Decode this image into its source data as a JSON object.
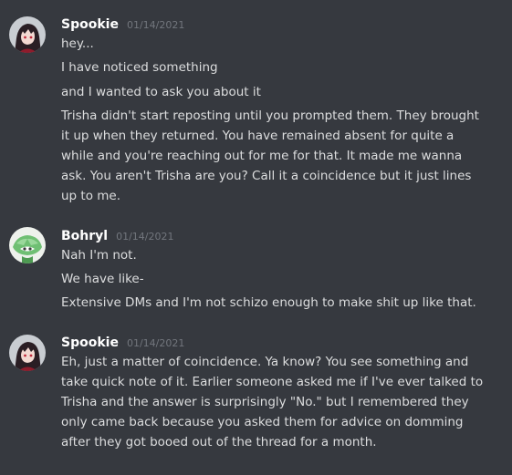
{
  "groups": [
    {
      "username": "Spookie",
      "timestamp": "01/14/2021",
      "avatar_icon": "spookie-avatar-icon",
      "messages": [
        {
          "lines": [
            "hey..."
          ]
        },
        {
          "lines": [
            "I have noticed something"
          ]
        },
        {
          "lines": [
            "and I wanted to ask you about it"
          ]
        },
        {
          "lines": [
            "Trisha didn't start reposting until you prompted them. They brought",
            "it up when they returned. You have remained absent for quite a",
            "while and you're reaching out for me for that. It made me wanna",
            "ask. You aren't Trisha are you? Call it a coincidence but it just lines",
            "up to me."
          ]
        }
      ]
    },
    {
      "username": "Bohryl",
      "timestamp": "01/14/2021",
      "avatar_icon": "bohryl-avatar-icon",
      "messages": [
        {
          "lines": [
            "Nah I'm not."
          ]
        },
        {
          "lines": [
            "We have like-"
          ]
        },
        {
          "lines": [
            "Extensive DMs and I'm not schizo enough to make shit up like that."
          ]
        }
      ]
    },
    {
      "username": "Spookie",
      "timestamp": "01/14/2021",
      "avatar_icon": "spookie-avatar-icon",
      "messages": [
        {
          "lines": [
            "Eh, just a matter of coincidence. Ya know? You see something and",
            "take quick note of it. Earlier someone asked me if I've ever talked to",
            "Trisha and the answer is surprisingly \"No.\" but I remembered they",
            "only came back because you asked them for advice on domming",
            "after they got booed out of the thread for a month."
          ]
        }
      ]
    }
  ],
  "colors": {
    "background": "#36393f",
    "username": "#ffffff",
    "timestamp": "#72767d",
    "message_text": "#dcddde"
  }
}
